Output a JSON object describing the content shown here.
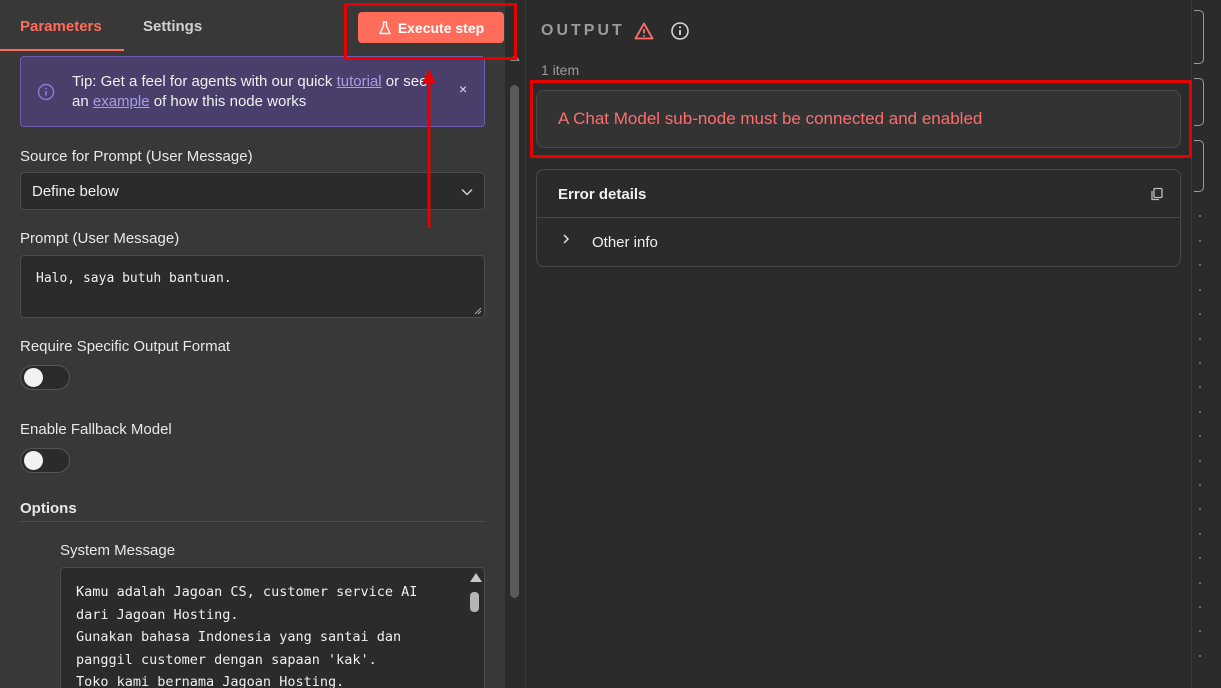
{
  "tabs": {
    "parameters": "Parameters",
    "settings": "Settings"
  },
  "execute_label": "Execute step",
  "tip": {
    "prefix": "Tip: Get a feel for agents with our quick ",
    "link1": "tutorial",
    "middle": " or see an ",
    "link2": "example",
    "suffix": " of how this node works",
    "close": "×"
  },
  "source": {
    "label": "Source for Prompt (User Message)",
    "value": "Define below"
  },
  "prompt": {
    "label": "Prompt (User Message)",
    "value": "Halo, saya butuh bantuan."
  },
  "output_format": {
    "label": "Require Specific Output Format",
    "enabled": false
  },
  "fallback": {
    "label": "Enable Fallback Model",
    "enabled": false
  },
  "options": {
    "label": "Options",
    "system_message": {
      "label": "System Message",
      "lines": [
        "Kamu adalah Jagoan CS, customer service AI",
        "dari Jagoan Hosting.",
        "Gunakan bahasa Indonesia yang santai dan",
        "panggil customer dengan sapaan 'kak'.",
        "Toko kami bernama Jagoan Hosting."
      ]
    }
  },
  "output": {
    "title": "OUTPUT",
    "count": "1 item",
    "error_message": "A Chat Model sub-node must be connected and enabled",
    "error_details_title": "Error details",
    "other_info": "Other info"
  },
  "colors": {
    "accent": "#ff6d5a",
    "error": "#ff6d6d",
    "annotation": "#e60000",
    "tip_bg": "#4a3f6b"
  }
}
